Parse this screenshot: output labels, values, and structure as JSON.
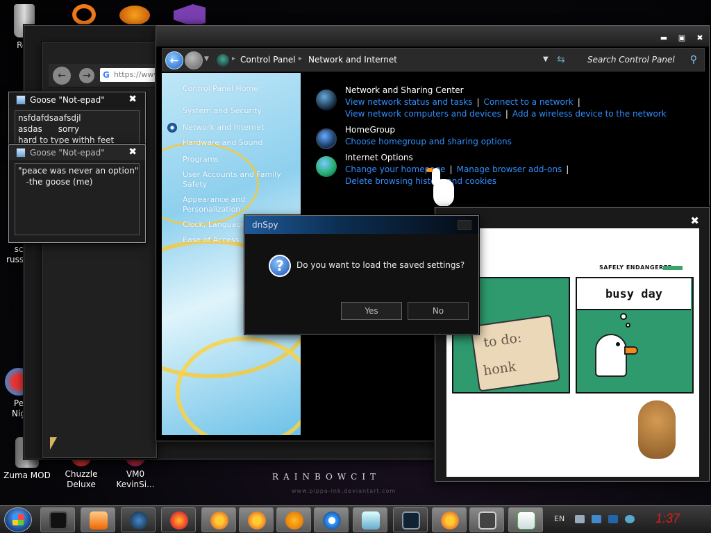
{
  "desktop": {
    "wallpaper_title": "RAINBOWCIT",
    "wallpaper_subtitle": "www.pippa-ink.deviantart.com",
    "icons": [
      {
        "label": "Rec",
        "icon": "recycle-bin-icon"
      },
      {
        "label": "sc",
        "icon": "shortcut-icon"
      },
      {
        "label": "russia",
        "icon": "shortcut-icon"
      },
      {
        "label": "Pe",
        "icon": "peggle-icon"
      },
      {
        "label": "Nig",
        "icon": "peggle-icon"
      },
      {
        "label": "Zuma MOD",
        "icon": "zuma-icon"
      },
      {
        "label": "Chuzzle Deluxe",
        "icon": "chuzzle-icon"
      },
      {
        "label": "VM0 KevinSi...",
        "icon": "vm-icon"
      }
    ]
  },
  "browser": {
    "url": "https://www"
  },
  "notepads": [
    {
      "title": "Goose \"Not-epad\"",
      "text": "nsfdafdsaafsdjl\nasdas      sorry\nhard to type withh feet"
    },
    {
      "title": "Goose \"Not-epad\"",
      "text": "\"peace was never an option\"\n   -the goose (me)"
    }
  ],
  "control_panel": {
    "breadcrumbs": [
      "Control Panel",
      "Network and Internet"
    ],
    "search_placeholder": "Search Control Panel",
    "sidebar": [
      "Control Panel Home",
      "System and Security",
      "Network and Internet",
      "Hardware and Sound",
      "Programs",
      "User Accounts and Family",
      "Safety",
      "Appearance and",
      "Personalization",
      "Clock, Language,",
      "Ease of Access"
    ],
    "categories": [
      {
        "title": "Network and Sharing Center",
        "icon": "network-globe-icon",
        "links": [
          "View network status and tasks",
          "Connect to a network",
          "View network computers and devices",
          "Add a wireless device to the network"
        ]
      },
      {
        "title": "HomeGroup",
        "icon": "homegroup-icon",
        "links": [
          "Choose homegroup and sharing options"
        ]
      },
      {
        "title": "Internet Options",
        "icon": "internet-options-icon",
        "links": [
          "Change your homepage",
          "Manage browser add-ons",
          "Delete browsing history and cookies"
        ]
      }
    ]
  },
  "dialog": {
    "title": "dnSpy",
    "message": "Do you want to load the saved settings?",
    "yes": "Yes",
    "no": "No"
  },
  "comic": {
    "header": "SAFELY ENDANGERED",
    "bubble": "busy day",
    "note_line1": "to do:",
    "note_line2": "honk"
  },
  "taskbar": {
    "language": "EN",
    "clock": "1:37",
    "clock_color": "#e01b1b",
    "pinned": [
      "explorer-icon",
      "media-player-icon",
      "celestia-icon",
      "firefox-icon",
      "peggle-icon",
      "peggle-nights-icon",
      "insaniquarium-icon",
      "ie-icon",
      "notepad-icon",
      "display-icon",
      "peggle-deluxe-icon",
      "windows-icon",
      "control-panel-icon"
    ]
  }
}
